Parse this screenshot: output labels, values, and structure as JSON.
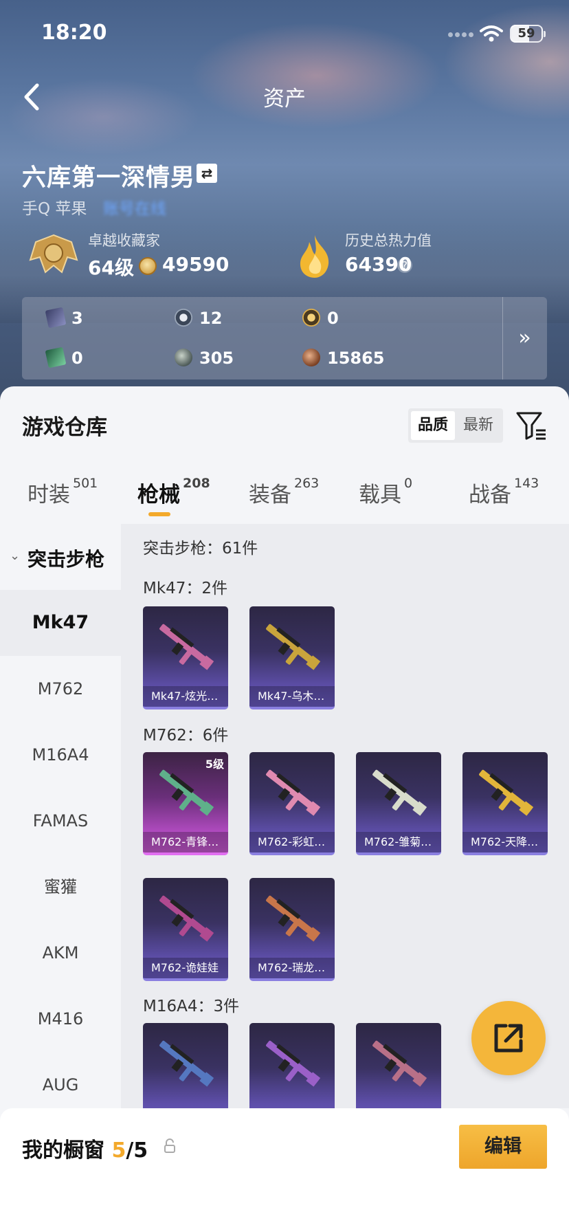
{
  "status_bar": {
    "time": "18:20",
    "battery": "59"
  },
  "nav": {
    "title": "资产"
  },
  "profile": {
    "name": "六库第一深情男",
    "platform": "手Q 苹果",
    "platform_extra": "账号在线",
    "collector_label": "卓越收藏家",
    "level": "64级",
    "coins": "49590",
    "heat_label": "历史总热力值",
    "heat_value": "64390",
    "help": "?"
  },
  "resources": [
    {
      "icon": "card-dark-icon",
      "value": "3"
    },
    {
      "icon": "silver-token-icon",
      "value": "12"
    },
    {
      "icon": "gold-token-icon",
      "value": "0"
    },
    {
      "icon": "card-green-icon",
      "value": "0"
    },
    {
      "icon": "gray-token-icon",
      "value": "305"
    },
    {
      "icon": "bronze-token-icon",
      "value": "15865"
    }
  ],
  "resources_more": "»",
  "warehouse": {
    "title": "游戏仓库",
    "sort_options": [
      "品质",
      "最新"
    ],
    "sort_selected": "品质"
  },
  "tabs": [
    {
      "label": "时装",
      "count": "501"
    },
    {
      "label": "枪械",
      "count": "208",
      "active": true
    },
    {
      "label": "装备",
      "count": "263"
    },
    {
      "label": "载具",
      "count": "0"
    },
    {
      "label": "战备",
      "count": "143"
    }
  ],
  "sidebar": {
    "category": "突击步枪",
    "items": [
      "Mk47",
      "M762",
      "M16A4",
      "FAMAS",
      "蜜獾",
      "AKM",
      "M416",
      "AUG"
    ],
    "selected": "Mk47"
  },
  "content": {
    "summary": "突击步枪：61件",
    "groups": [
      {
        "heading": "Mk47：2件",
        "items": [
          {
            "label": "Mk47-炫光…",
            "color": "#c86aa0"
          },
          {
            "label": "Mk47-乌木…",
            "color": "#c9a43c"
          }
        ]
      },
      {
        "heading": "M762：6件",
        "items": [
          {
            "label": "M762-青锋…",
            "color": "#5fb08a",
            "level": "5级",
            "rarity": "pink"
          },
          {
            "label": "M762-彩虹…",
            "color": "#e08ab0"
          },
          {
            "label": "M762-雏菊…",
            "color": "#d8dccb"
          },
          {
            "label": "M762-天降…",
            "color": "#e2b53a"
          },
          {
            "label": "M762-诡娃娃",
            "color": "#b04a90"
          },
          {
            "label": "M762-瑞龙…",
            "color": "#c8764a"
          }
        ]
      },
      {
        "heading": "M16A4：3件",
        "items": [
          {
            "label": "",
            "color": "#5578c0"
          },
          {
            "label": "",
            "color": "#9a60c8"
          },
          {
            "label": "",
            "color": "#b87088"
          }
        ]
      }
    ]
  },
  "showcase": {
    "label": "我的橱窗",
    "current": "5",
    "total": "/5",
    "edit": "编辑"
  }
}
